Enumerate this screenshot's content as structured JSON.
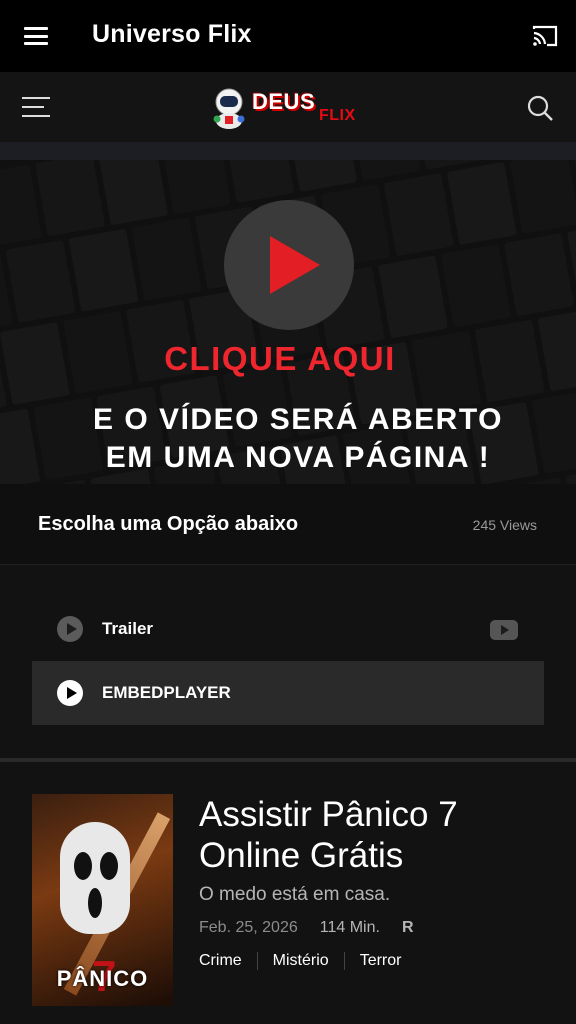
{
  "app_bar": {
    "title": "Universo Flix"
  },
  "site_header": {
    "logo_main": "DEUS",
    "logo_sub": "FLIX"
  },
  "banner": {
    "cta": "CLIQUE AQUI",
    "line1": "E O VÍDEO SERÁ ABERTO",
    "line2": "EM UMA NOVA PÁGINA !"
  },
  "options": {
    "heading": "Escolha uma Opção abaixo",
    "views": "245 Views",
    "items": [
      {
        "label": "Trailer",
        "icon": "youtube-icon"
      },
      {
        "label": "EMBEDPLAYER",
        "icon": "play-icon"
      }
    ]
  },
  "movie": {
    "poster_title": "PÂNICO",
    "poster_number": "7",
    "title": "Assistir Pânico 7 Online Grátis",
    "tagline": "O medo está em casa.",
    "date": "Feb. 25, 2026",
    "duration": "114 Min.",
    "rating": "R",
    "genres": [
      "Crime",
      "Mistério",
      "Terror"
    ]
  },
  "colors": {
    "accent": "#e31e24",
    "background": "#121212"
  }
}
